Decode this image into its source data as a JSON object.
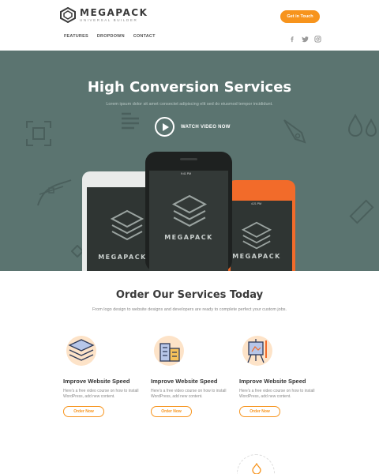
{
  "header": {
    "logo_name": "MEGAPACK",
    "logo_sub": "UNIVERSAL BUILDER",
    "cta_label": "Get in Touch",
    "nav": [
      "FEATURES",
      "DROPDOWN",
      "CONTACT"
    ]
  },
  "social": [
    "facebook-icon",
    "twitter-icon",
    "instagram-icon"
  ],
  "hero": {
    "title": "High Conversion Services",
    "subtitle": "Lorem ipsum dolor sit amet consectet adipiscing elit sed do eiusmod tempor incididunt.",
    "watch_label": "WATCH VIDEO NOW",
    "phone_brand": "MEGAPACK",
    "phone_left_status": "",
    "phone_center_status": "9:41 PM",
    "phone_right_status": "4:21 PM"
  },
  "services": {
    "title": "Order Our Services Today",
    "subtitle": "From logo design to website designs and developers are ready to complete perfect your custom jobs.",
    "cards": [
      {
        "title": "Improve Website Speed",
        "desc": "Here's a free video course on how to install WordPress, add new content.",
        "button": "Order Now",
        "icon": "layers-icon"
      },
      {
        "title": "Improve Website Speed",
        "desc": "Here's a free video course on how to install WordPress, add new content.",
        "button": "Order Now",
        "icon": "building-icon"
      },
      {
        "title": "Improve Website Speed",
        "desc": "Here's a free video course on how to install WordPress, add new content.",
        "button": "Order Now",
        "icon": "easel-icon"
      }
    ]
  },
  "colors": {
    "accent": "#f7941d",
    "hero_bg": "#5b7470",
    "phone_orange": "#f26b2a"
  }
}
